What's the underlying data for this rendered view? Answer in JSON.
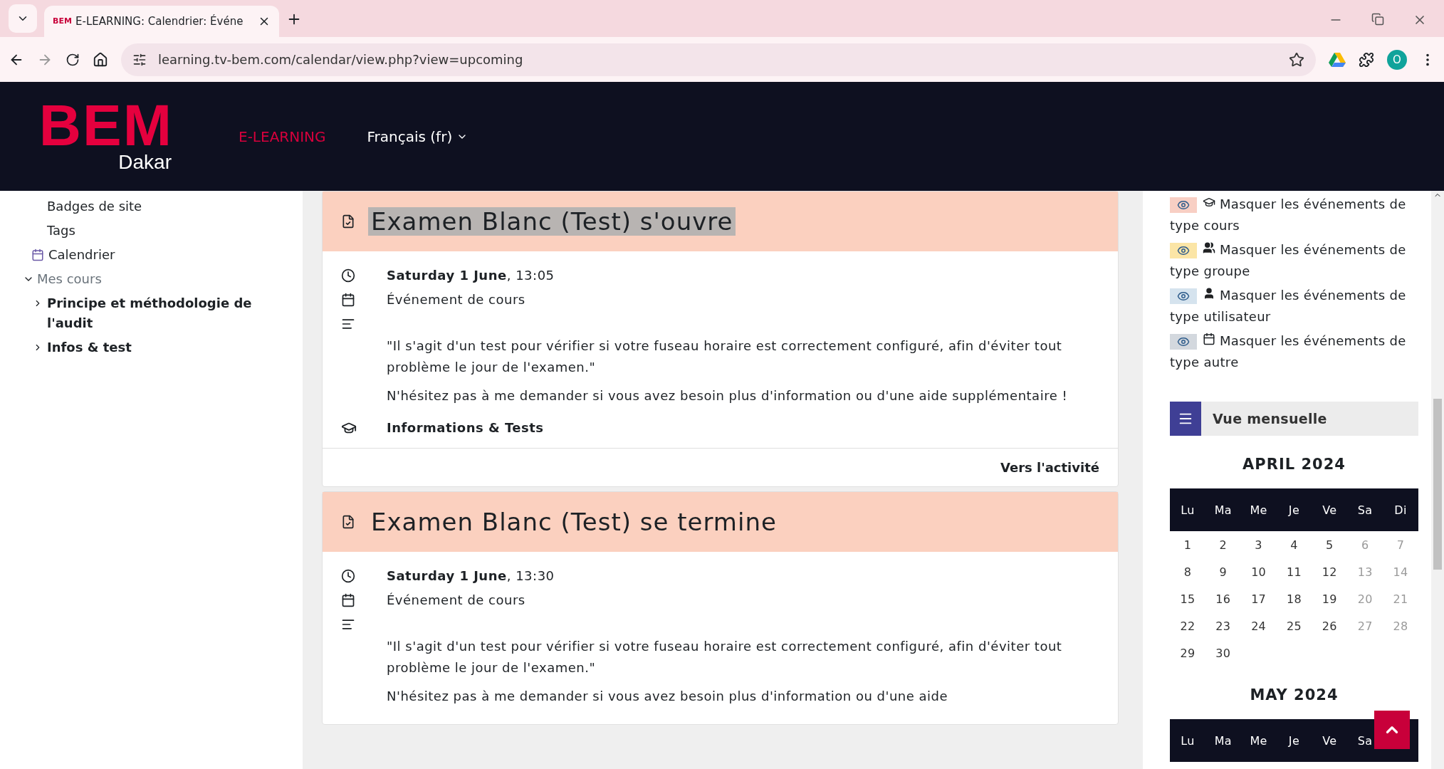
{
  "browser": {
    "tab_title": "E-LEARNING: Calendrier: Événe",
    "url": "learning.tv-bem.com/calendar/view.php?view=upcoming",
    "profile_initial": "O",
    "favicon": "BEM"
  },
  "header": {
    "logo": "BEM",
    "logo_sub": "Dakar",
    "nav": [
      {
        "label": "E-LEARNING",
        "selected": true
      },
      {
        "label": "Français (fr)",
        "selected": false,
        "kind": "dropdown"
      }
    ]
  },
  "sidebar": {
    "items": [
      {
        "label": "Badges de site",
        "kind": "plain"
      },
      {
        "label": "Tags",
        "kind": "plain"
      },
      {
        "label": "Calendrier",
        "kind": "calendar"
      },
      {
        "label": "Mes cours",
        "kind": "section",
        "expanded": true,
        "children": [
          {
            "label": "Principe et méthodologie de l'audit",
            "expanded": false
          },
          {
            "label": "Infos & test",
            "expanded": false
          }
        ]
      }
    ]
  },
  "events": [
    {
      "title": "Examen Blanc (Test) s'ouvre",
      "highlighted": true,
      "date": "Saturday 1 June",
      "time": ", 13:05",
      "type": "Événement de cours",
      "description": [
        "\"Il s'agit d'un test pour vérifier si votre fuseau horaire est correctement configuré, afin d'éviter tout problème le jour de l'examen.\"",
        "N'hésitez pas à me demander si vous avez besoin plus d'information ou d'une aide supplémentaire !"
      ],
      "course": "Informations & Tests",
      "action": "Vers l'activité"
    },
    {
      "title": "Examen Blanc (Test) se termine",
      "highlighted": false,
      "date": "Saturday 1 June",
      "time": ", 13:30",
      "type": "Événement de cours",
      "description": [
        "\"Il s'agit d'un test pour vérifier si votre fuseau horaire est correctement configuré, afin d'éviter tout problème le jour de l'examen.\"",
        "N'hésitez pas à me demander si vous avez besoin plus d'information ou d'une aide"
      ]
    }
  ],
  "legend": [
    {
      "kind": "course",
      "label": "Masquer les événements de type cours",
      "color": "#f8cfc4"
    },
    {
      "kind": "group",
      "label": "Masquer les événements de type groupe",
      "color": "#fbe5a6"
    },
    {
      "kind": "user",
      "label": "Masquer les événements de type utilisateur",
      "color": "#d5e3ee"
    },
    {
      "kind": "other",
      "label": "Masquer les événements de type autre",
      "color": "#d3d8de"
    }
  ],
  "month_view": {
    "label": "Vue mensuelle"
  },
  "months": [
    {
      "title": "APRIL 2024",
      "weekdays": [
        "Lu",
        "Ma",
        "Me",
        "Je",
        "Ve",
        "Sa",
        "Di"
      ],
      "weeks": [
        [
          "1",
          "2",
          "3",
          "4",
          "5",
          "6",
          "7"
        ],
        [
          "8",
          "9",
          "10",
          "11",
          "12",
          "13",
          "14"
        ],
        [
          "15",
          "16",
          "17",
          "18",
          "19",
          "20",
          "21"
        ],
        [
          "22",
          "23",
          "24",
          "25",
          "26",
          "27",
          "28"
        ],
        [
          "29",
          "30"
        ]
      ]
    },
    {
      "title": "MAY 2024",
      "weekdays": [
        "Lu",
        "Ma",
        "Me",
        "Je",
        "Ve",
        "Sa"
      ]
    }
  ]
}
